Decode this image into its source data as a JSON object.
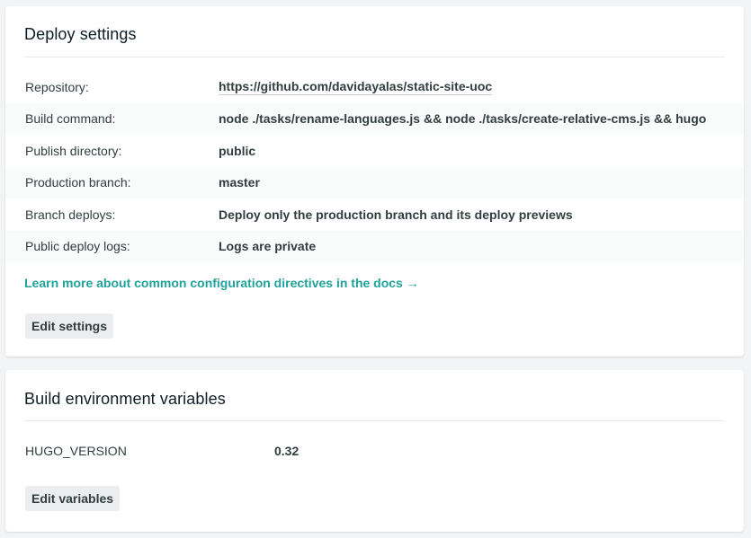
{
  "deploy_settings": {
    "title": "Deploy settings",
    "rows": [
      {
        "label": "Repository:",
        "value": "https://github.com/davidayalas/static-site-uoc"
      },
      {
        "label": "Build command:",
        "value": "node ./tasks/rename-languages.js && node ./tasks/create-relative-cms.js && hugo"
      },
      {
        "label": "Publish directory:",
        "value": "public"
      },
      {
        "label": "Production branch:",
        "value": "master"
      },
      {
        "label": "Branch deploys:",
        "value": "Deploy only the production branch and its deploy previews"
      },
      {
        "label": "Public deploy logs:",
        "value": "Logs are private"
      }
    ],
    "docs_link": "Learn more about common configuration directives in the docs →",
    "edit_button": "Edit settings"
  },
  "build_env": {
    "title": "Build environment variables",
    "variables": [
      {
        "key": "HUGO_VERSION",
        "value": "0.32"
      }
    ],
    "edit_button": "Edit variables"
  },
  "colors": {
    "link": "#20a19a",
    "text": "#313d3e",
    "background": "#f3f4f5"
  }
}
